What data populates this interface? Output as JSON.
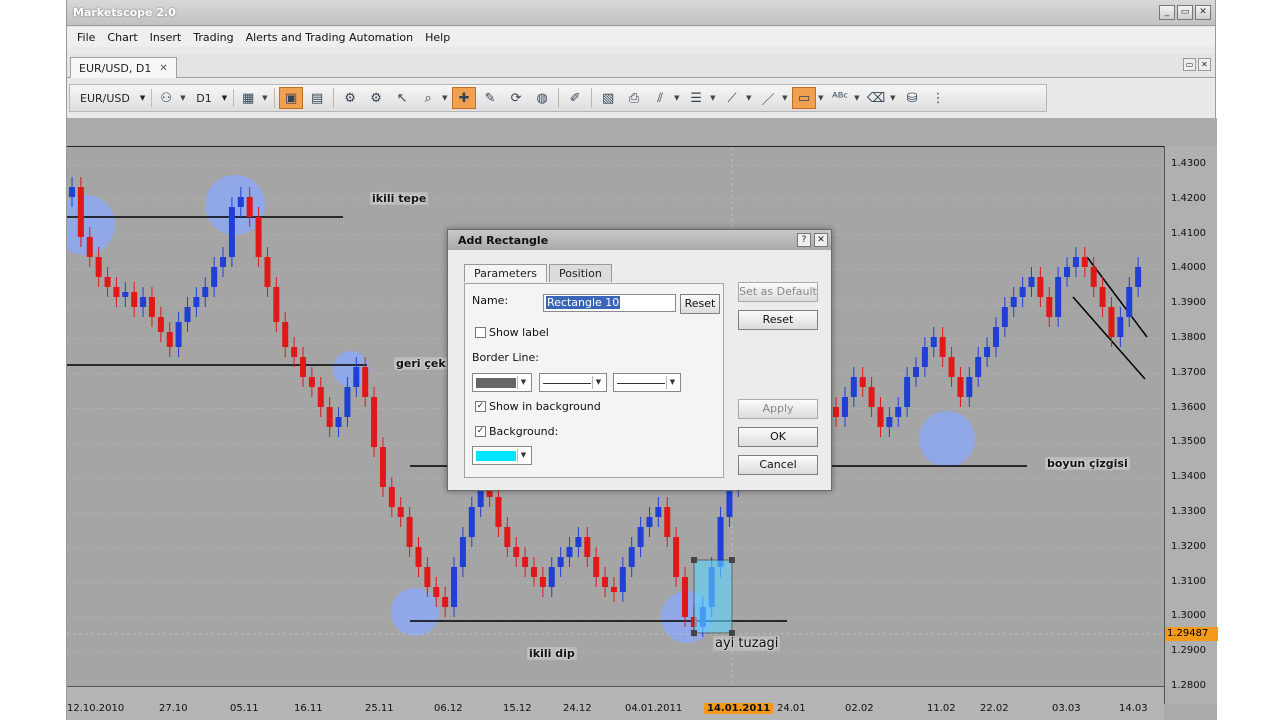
{
  "app": {
    "title": "Marketscope 2.0"
  },
  "window_buttons": [
    "_",
    "▭",
    "✕"
  ],
  "menu": [
    "File",
    "Chart",
    "Insert",
    "Trading",
    "Alerts and Trading Automation",
    "Help"
  ],
  "document_tab": {
    "label": "EUR/USD, D1",
    "close": "✕"
  },
  "toolbar": {
    "symbol": "EUR/USD",
    "timeframe": "D1"
  },
  "annotations": {
    "top": "ikili tepe",
    "pullback": "geri çek",
    "bottom": "ikili dip",
    "neckline": "boyun çizgisi",
    "bear_trap": "ayi tuzagi"
  },
  "price_axis": {
    "ticks": [
      "1.4300",
      "1.4200",
      "1.4100",
      "1.4000",
      "1.3900",
      "1.3800",
      "1.3700",
      "1.3600",
      "1.3500",
      "1.3400",
      "1.3300",
      "1.3200",
      "1.3100",
      "1.3000",
      "1.2900",
      "1.2800"
    ],
    "current": "1.29487"
  },
  "time_axis": {
    "labels": [
      "12.10.2010",
      "27.10",
      "05.11",
      "16.11",
      "25.11",
      "06.12",
      "15.12",
      "24.12",
      "04.01.2011",
      "14.01.2011",
      "24.01",
      "02.02",
      "11.02",
      "22.02",
      "03.03",
      "14.03"
    ],
    "current": "14.01.2011"
  },
  "dialog": {
    "title": "Add Rectangle",
    "tabs": [
      "Parameters",
      "Position"
    ],
    "name_label": "Name:",
    "name_value": "Rectangle 10",
    "reset_name": "Reset",
    "show_label": "Show label",
    "border_line": "Border Line:",
    "show_in_background": "Show in background",
    "background": "Background:",
    "set_as_default": "Set as Default",
    "reset": "Reset",
    "apply": "Apply",
    "ok": "OK",
    "cancel": "Cancel",
    "border_color": "#666666",
    "background_color": "#00e5ff"
  },
  "colors": {
    "bull": "#1f3fd6",
    "bear": "#e01818",
    "highlight": "#8aa8ff",
    "rectangle": "#5fd6ff"
  }
}
